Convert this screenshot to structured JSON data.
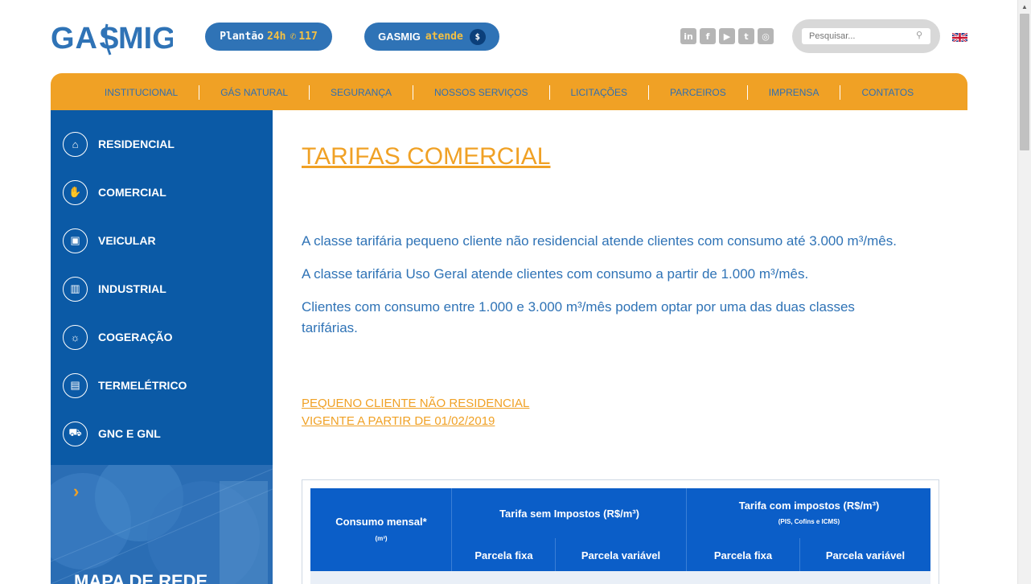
{
  "header": {
    "logo_text": "GASMIG",
    "plantao_label": "Plantão",
    "plantao_highlight": "24h",
    "plantao_phone": "117",
    "atende_brand": "GASMIG",
    "atende_label": "atende",
    "search_placeholder": "Pesquisar...",
    "social_icons": [
      "linkedin-icon",
      "facebook-icon",
      "youtube-icon",
      "twitter-icon",
      "instagram-icon"
    ]
  },
  "nav": {
    "items": [
      "INSTITUCIONAL",
      "GÁS NATURAL",
      "SEGURANÇA",
      "NOSSOS SERVIÇOS",
      "LICITAÇÕES",
      "PARCEIROS",
      "IMPRENSA",
      "CONTATOS"
    ]
  },
  "sidebar": {
    "items": [
      {
        "label": "RESIDENCIAL",
        "icon": "house-icon"
      },
      {
        "label": "COMERCIAL",
        "icon": "handshake-icon"
      },
      {
        "label": "VEICULAR",
        "icon": "truck-icon"
      },
      {
        "label": "INDUSTRIAL",
        "icon": "factory-icon"
      },
      {
        "label": "COGERAÇÃO",
        "icon": "bulb-icon"
      },
      {
        "label": "TERMELÉTRICO",
        "icon": "plant-icon"
      },
      {
        "label": "GNC E GNL",
        "icon": "tanker-icon"
      }
    ],
    "promo_title": "MAPA DE REDE"
  },
  "main": {
    "title": "TARIFAS COMERCIAL",
    "paragraphs": [
      "A classe tarifária pequeno cliente não residencial atende clientes com consumo até 3.000 m³/mês.",
      "A classe tarifária Uso Geral atende clientes com consumo a partir de  1.000 m³/mês.",
      "Clientes com consumo entre 1.000 e 3.000 m³/mês podem optar por uma das duas classes tarifárias."
    ],
    "sub_title_1": "PEQUENO CLIENTE NÃO RESIDENCIAL",
    "sub_title_2": "VIGENTE A PARTIR DE 01/02/2019"
  },
  "table": {
    "consumo_header": "Consumo mensal*",
    "consumo_unit": "(m³)",
    "sem_impostos_header": "Tarifa sem Impostos (R$/m³)",
    "com_impostos_header": "Tarifa com impostos (R$/m³)",
    "com_impostos_note": "(PIS, Cofins e ICMS)",
    "sub_headers": [
      "Parcela fixa",
      "Parcela variável",
      "Parcela fixa",
      "Parcela variável"
    ]
  },
  "colors": {
    "brand_blue": "#2f73b6",
    "nav_orange": "#f0a125",
    "sidebar_blue": "#0b5aa6",
    "table_blue": "#0b5ec8"
  }
}
